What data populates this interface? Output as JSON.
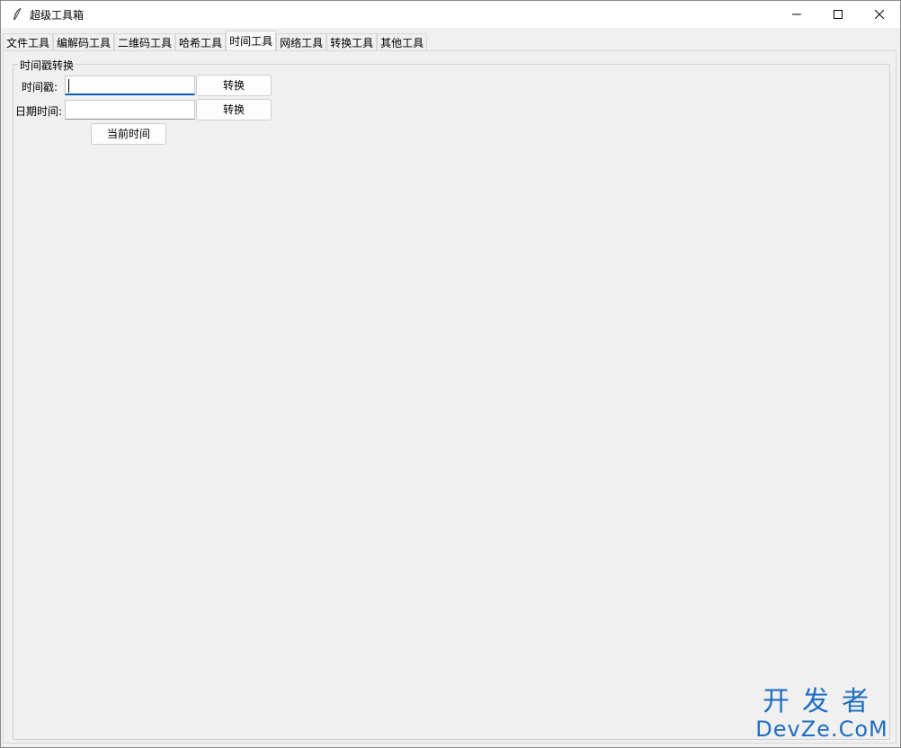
{
  "window": {
    "title": "超级工具箱"
  },
  "tabs": [
    {
      "label": "文件工具"
    },
    {
      "label": "编解码工具"
    },
    {
      "label": "二维码工具"
    },
    {
      "label": "哈希工具"
    },
    {
      "label": "时间工具",
      "active": true
    },
    {
      "label": "网络工具"
    },
    {
      "label": "转换工具"
    },
    {
      "label": "其他工具"
    }
  ],
  "group": {
    "title": "时间戳转换",
    "timestamp_label": "时间戳:",
    "timestamp_value": "",
    "timestamp_convert_label": "转换",
    "datetime_label": "日期时间:",
    "datetime_value": "",
    "datetime_convert_label": "转换",
    "now_button_label": "当前时间"
  },
  "watermark": {
    "line1": "开发者",
    "line2": "DevZe.CoM"
  },
  "colors": {
    "accent": "#0a5fb4",
    "watermark": "#1f6fc0"
  }
}
